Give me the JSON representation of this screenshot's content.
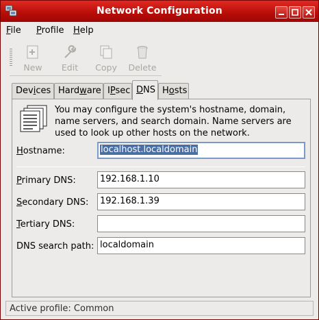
{
  "window": {
    "title": "Network Configuration"
  },
  "menubar": {
    "items": [
      "File",
      "Profile",
      "Help"
    ]
  },
  "toolbar": {
    "buttons": [
      "New",
      "Edit",
      "Copy",
      "Delete"
    ]
  },
  "tabs": [
    "Devices",
    "Hardware",
    "IPsec",
    "DNS",
    "Hosts"
  ],
  "active_tab": "DNS",
  "dns": {
    "info": "You may configure the system's hostname, domain, name servers, and search domain. Name servers are used to look up other hosts on the network.",
    "hostname_label": "Hostname:",
    "hostname_value": "localhost.localdomain",
    "primary_label": "Primary DNS:",
    "primary_value": "192.168.1.10",
    "secondary_label": "Secondary DNS:",
    "secondary_value": "192.168.1.39",
    "tertiary_label": "Tertiary DNS:",
    "tertiary_value": "",
    "search_label": "DNS search path:",
    "search_value": "localdomain"
  },
  "status": {
    "text": "Active profile: Common"
  },
  "colors": {
    "titlebar": "#b80c08",
    "selection": "#4a6fa5",
    "window_bg": "#ecebe9"
  }
}
